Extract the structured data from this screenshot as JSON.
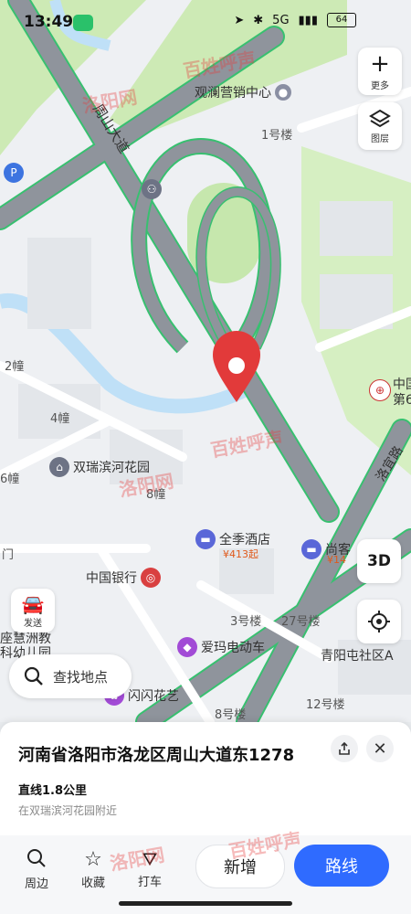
{
  "status_bar": {
    "time": "13:49",
    "battery": "64",
    "net": "5G"
  },
  "map": {
    "roads": {
      "main": "周山大道",
      "secondary": "洛宜路"
    },
    "pois": {
      "guanlan": "观澜营销中心",
      "shuangrui": "双瑞滨河花园",
      "quanji": "全季酒店",
      "quanji_price": "¥413起",
      "shangke": "尚客",
      "shangke_price": "¥14",
      "bank": "中国银行",
      "aima": "爱玛电动车",
      "shanshan": "闪闪花艺",
      "qingyang": "青阳屯社区A",
      "zhongguo": "中国",
      "zhongguo2": "第6",
      "kindergarten1": "座慧洲教",
      "kindergarten2": "科幼儿园"
    },
    "buildings": {
      "b1": "1号楼",
      "b2": "2幢",
      "b4": "4幢",
      "b8": "8幢",
      "b3": "3号楼",
      "b27": "27号楼",
      "b12": "12号楼",
      "b8lou": "8号楼",
      "b6": "6幢",
      "men": "门",
      "guan": "观"
    }
  },
  "controls": {
    "more": "更多",
    "layers": "图层",
    "threeD": "3D",
    "send": "发送",
    "search_placeholder": "查找地点"
  },
  "sheet": {
    "address": "河南省洛阳市洛龙区周山大道东1278",
    "distance": "直线1.8公里",
    "near": "在双瑞滨河花园附近"
  },
  "actions": {
    "nearby": "周边",
    "favorite": "收藏",
    "taxi": "打车",
    "new": "新增",
    "route": "路线"
  },
  "watermarks": {
    "a": "洛阳网",
    "b": "百姓呼声"
  },
  "colors": {
    "accent": "#2f6bff",
    "road": "#8f949c",
    "green": "#c8e9b0",
    "water": "#bfe0f7",
    "pin": "#e23a3a"
  }
}
